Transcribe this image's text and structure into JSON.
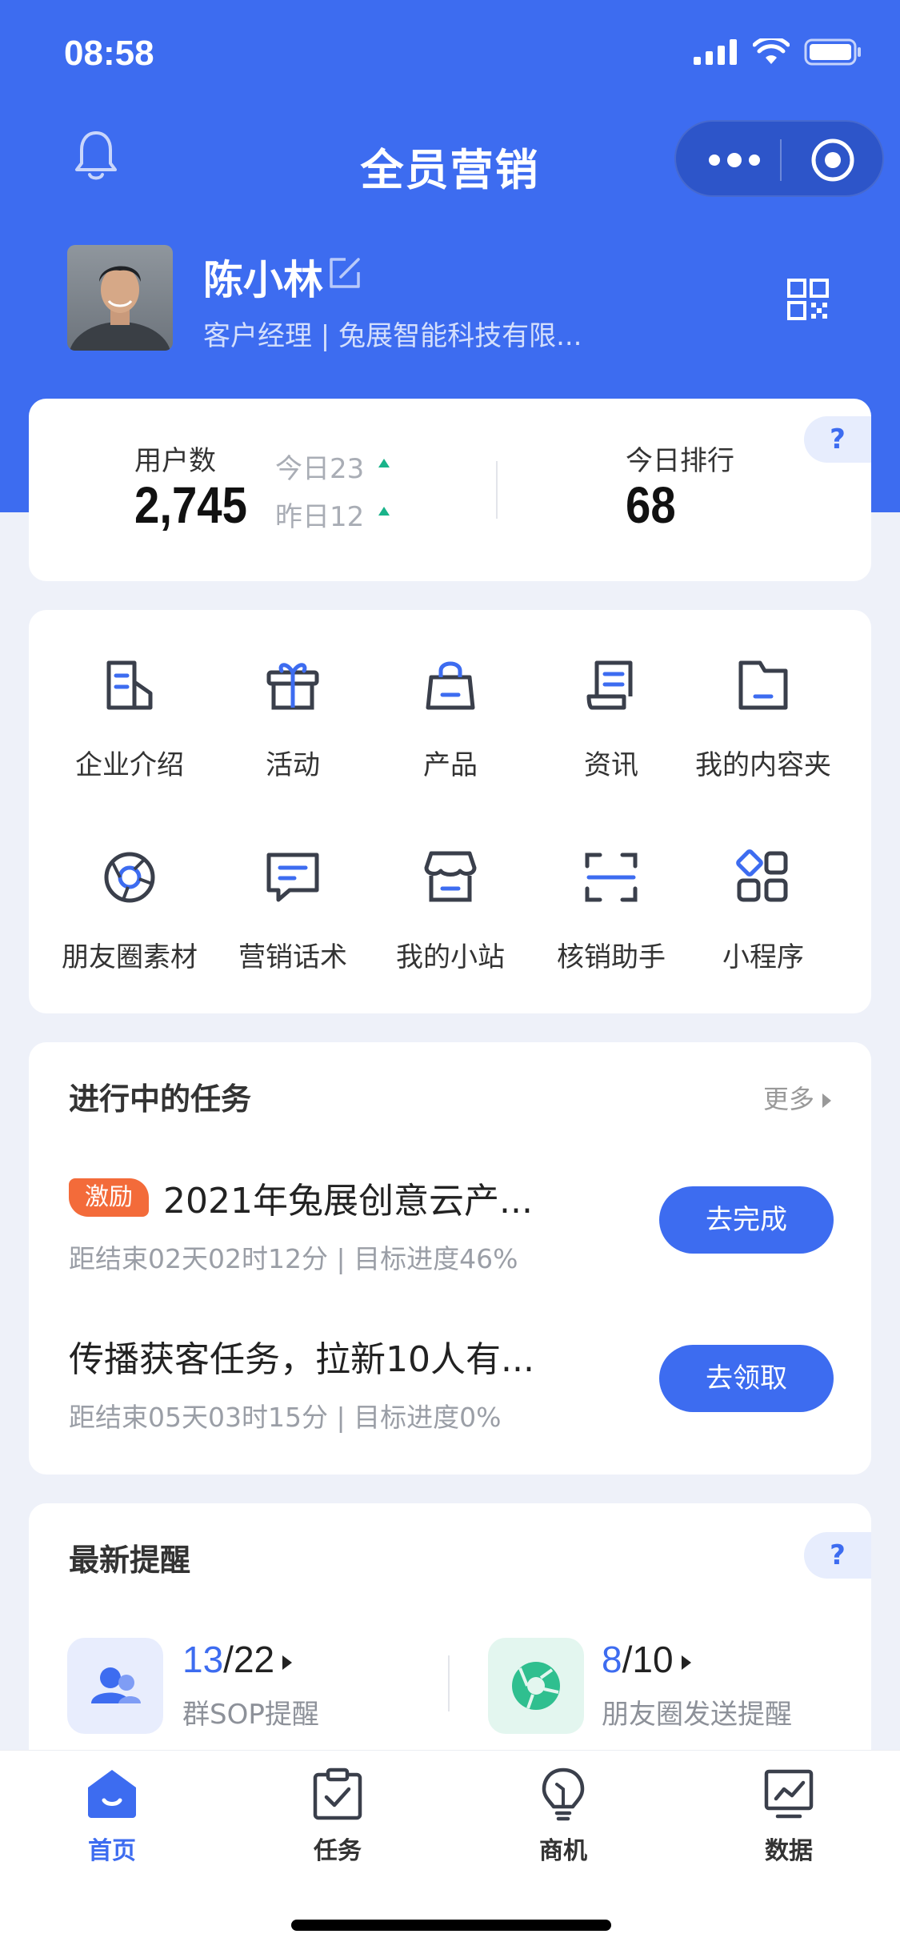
{
  "status_bar": {
    "time": "08:58"
  },
  "nav": {
    "title": "全员营销"
  },
  "profile": {
    "name": "陈小林",
    "subtitle": "客户经理 | 兔展智能科技有限..."
  },
  "stats": {
    "users_label": "用户数",
    "users_value": "2,745",
    "today": "今日23",
    "yesterday": "昨日12",
    "rank_label": "今日排行",
    "rank_value": "68",
    "help": "?"
  },
  "grid": [
    {
      "label": "企业介绍",
      "icon": "building-icon"
    },
    {
      "label": "活动",
      "icon": "gift-icon"
    },
    {
      "label": "产品",
      "icon": "bag-icon"
    },
    {
      "label": "资讯",
      "icon": "scroll-icon"
    },
    {
      "label": "我的内容夹",
      "icon": "folder-icon"
    },
    {
      "label": "朋友圈素材",
      "icon": "aperture-icon"
    },
    {
      "label": "营销话术",
      "icon": "chat-icon"
    },
    {
      "label": "我的小站",
      "icon": "store-icon"
    },
    {
      "label": "核销助手",
      "icon": "scan-icon"
    },
    {
      "label": "小程序",
      "icon": "apps-icon"
    }
  ],
  "tasks": {
    "title": "进行中的任务",
    "more": "更多",
    "items": [
      {
        "badge": "激励",
        "title": "2021年兔展创意云产...",
        "meta": "距结束02天02时12分  |  目标进度46%",
        "button": "去完成"
      },
      {
        "title": "传播获客任务，拉新10人有...",
        "meta": "距结束05天03时15分  |  目标进度0%",
        "button": "去领取"
      }
    ]
  },
  "reminders": {
    "title": "最新提醒",
    "help": "?",
    "items": [
      {
        "done": "13",
        "total": "/22",
        "label": "群SOP提醒",
        "icon": "group-icon"
      },
      {
        "done": "8",
        "total": "/10",
        "label": "朋友圈发送提醒",
        "icon": "moments-icon"
      }
    ]
  },
  "tabbar": [
    {
      "label": "首页",
      "icon": "home-icon",
      "active": true
    },
    {
      "label": "任务",
      "icon": "clipboard-icon",
      "active": false
    },
    {
      "label": "商机",
      "icon": "lightbulb-icon",
      "active": false
    },
    {
      "label": "数据",
      "icon": "chart-icon",
      "active": false
    }
  ],
  "colors": {
    "brand": "#3d6cf0",
    "badge": "#f36b3a",
    "up": "#19b38a"
  }
}
